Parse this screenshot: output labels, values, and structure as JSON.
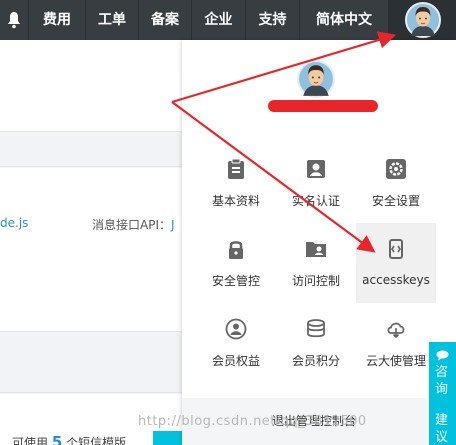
{
  "topbar": {
    "items": [
      "费用",
      "工单",
      "备案",
      "企业",
      "支持",
      "简体中文"
    ],
    "bell_icon": "bell-icon",
    "avatar_icon": "user-avatar"
  },
  "background": {
    "link_text": "de.js",
    "api_label": "消息接口API：",
    "api_link": "J",
    "available_prefix": "可使用",
    "available_count": "5",
    "available_suffix": "个短信模版"
  },
  "panel": {
    "items": [
      {
        "label": "基本资料",
        "icon": "profile-clipboard-icon"
      },
      {
        "label": "实名认证",
        "icon": "id-card-icon"
      },
      {
        "label": "安全设置",
        "icon": "gear-icon"
      },
      {
        "label": "安全管控",
        "icon": "lock-icon"
      },
      {
        "label": "访问控制",
        "icon": "user-folder-icon"
      },
      {
        "label": "accesskeys",
        "icon": "key-code-icon",
        "highlighted": true
      },
      {
        "label": "会员权益",
        "icon": "member-icon"
      },
      {
        "label": "会员积分",
        "icon": "coins-icon"
      },
      {
        "label": "云大使管理",
        "icon": "cloud-ambassador-icon"
      }
    ],
    "logout": "退出管理控制台"
  },
  "side_tab": {
    "line1": "咨询",
    "line2": "建议"
  },
  "watermark": "http://blog.csdn.net/qq_3812500",
  "colors": {
    "topbar": "#373d41",
    "accent": "#00c1de",
    "link": "#2a8ecb",
    "annotation": "#e8262a"
  }
}
